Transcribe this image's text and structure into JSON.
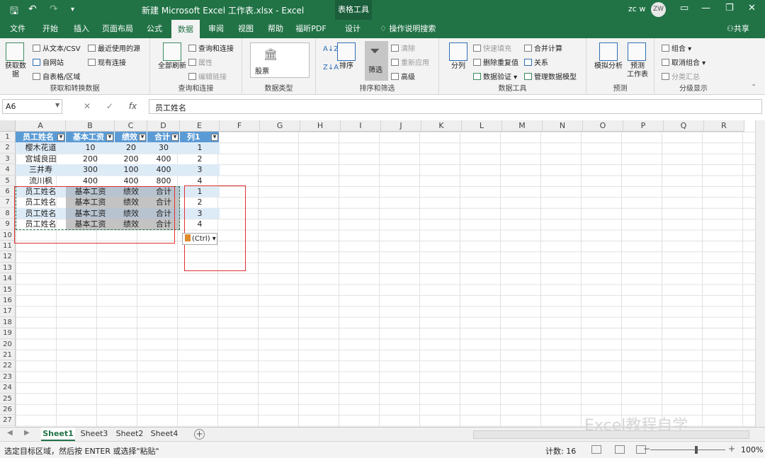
{
  "titlebar": {
    "title": "新建 Microsoft Excel 工作表.xlsx  -  Excel",
    "context_tab": "表格工具",
    "user": "zc w",
    "avatar": "ZW",
    "save_icon": "save-icon",
    "undo_icon": "undo-icon",
    "redo_icon": "redo-icon"
  },
  "tabs": [
    "文件",
    "开始",
    "插入",
    "页面布局",
    "公式",
    "数据",
    "审阅",
    "视图",
    "帮助",
    "福昕PDF",
    "设计"
  ],
  "active_tab": "数据",
  "tell_me": "操作说明搜索",
  "share": "共享",
  "ribbon": {
    "get_data": {
      "label": "获取数\n据",
      "items": [
        "从文本/CSV",
        "自网站",
        "自表格/区域",
        "最近使用的源",
        "现有连接"
      ],
      "group": "获取和转换数据"
    },
    "queries": {
      "refresh": "全部刷新",
      "items": [
        "查询和连接",
        "属性",
        "编辑链接"
      ],
      "group": "查询和连接"
    },
    "data_types": {
      "stock": "股票",
      "group": "数据类型"
    },
    "sort_filter": {
      "sort": "排序",
      "filter": "筛选",
      "items": [
        "清除",
        "重新应用",
        "高级"
      ],
      "group": "排序和筛选"
    },
    "data_tools": {
      "split": "分列",
      "items": [
        "快速填充",
        "删除重复值",
        "数据验证",
        "合并计算",
        "关系",
        "管理数据模型"
      ],
      "group": "数据工具"
    },
    "forecast": {
      "whatif": "模拟分析",
      "sheet": "预测\n工作表",
      "group": "预测"
    },
    "outline": {
      "items": [
        "组合",
        "取消组合",
        "分类汇总"
      ],
      "group": "分级显示"
    }
  },
  "formula_bar": {
    "name_box": "A6",
    "fx": "fx",
    "content": "员工姓名"
  },
  "columns": [
    "A",
    "B",
    "C",
    "D",
    "E",
    "F",
    "G",
    "H",
    "I",
    "J",
    "K",
    "L",
    "M",
    "N",
    "O",
    "P",
    "Q",
    "R"
  ],
  "rows": [
    "1",
    "2",
    "3",
    "4",
    "5",
    "6",
    "7",
    "8",
    "9",
    "10",
    "11",
    "12",
    "13",
    "14",
    "15",
    "16",
    "17",
    "18",
    "19",
    "20",
    "21",
    "22",
    "23",
    "24",
    "25",
    "26",
    "27"
  ],
  "table": {
    "headers": [
      "员工姓名",
      "基本工资",
      "绩效",
      "合计",
      "列1"
    ],
    "rows": [
      [
        "樱木花道",
        "10",
        "20",
        "30",
        "1"
      ],
      [
        "宫城良田",
        "200",
        "200",
        "400",
        "2"
      ],
      [
        "三井寿",
        "300",
        "100",
        "400",
        "3"
      ],
      [
        "流川枫",
        "400",
        "400",
        "800",
        "4"
      ]
    ]
  },
  "pasted_rows": [
    [
      "员工姓名",
      "基本工资",
      "绩效",
      "合计",
      "1"
    ],
    [
      "员工姓名",
      "基本工资",
      "绩效",
      "合计",
      "2"
    ],
    [
      "员工姓名",
      "基本工资",
      "绩效",
      "合计",
      "3"
    ],
    [
      "员工姓名",
      "基本工资",
      "绩效",
      "合计",
      "4"
    ]
  ],
  "paste_options": "(Ctrl)",
  "sheets": [
    "Sheet1",
    "Sheet3",
    "Sheet2",
    "Sheet4"
  ],
  "active_sheet": "Sheet1",
  "watermark": "Excel教程自学",
  "status": {
    "message": "选定目标区域，然后按 ENTER 或选择\"粘贴\"",
    "count": "计数: 16",
    "zoom": "100%"
  }
}
